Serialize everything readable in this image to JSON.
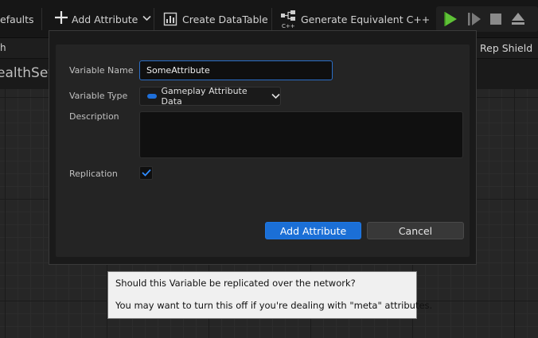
{
  "toolbar": {
    "defaults_label": "efaults",
    "add_attribute_label": "Add Attribute",
    "create_datatable_label": "Create DataTable",
    "generate_cpp_label": "Generate Equivalent C++",
    "icons": [
      "plus-icon",
      "chevron-down-icon",
      "datatable-icon",
      "cpp-class-icon",
      "play-icon",
      "step-icon",
      "stop-icon",
      "eject-icon"
    ]
  },
  "strip": {
    "left_label": "h",
    "right_label": "Rep Shield",
    "title_fragment": "ealthSet"
  },
  "dialog": {
    "variable_name_label": "Variable Name",
    "variable_name_value": "SomeAttribute",
    "variable_type_label": "Variable Type",
    "variable_type_value": "Gameplay Attribute Data",
    "description_label": "Description",
    "description_value": "",
    "replication_label": "Replication",
    "replication_checked": true,
    "add_button_label": "Add Attribute",
    "cancel_button_label": "Cancel"
  },
  "tooltip": {
    "line1": "Should this Variable be replicated over the network?",
    "line2": "You may want to turn this off if you're dealing with \"meta\" attributes."
  },
  "colors": {
    "accent": "#1b6fd6",
    "play_green": "#5ec236",
    "pin_blue": "#1e6fd9"
  }
}
